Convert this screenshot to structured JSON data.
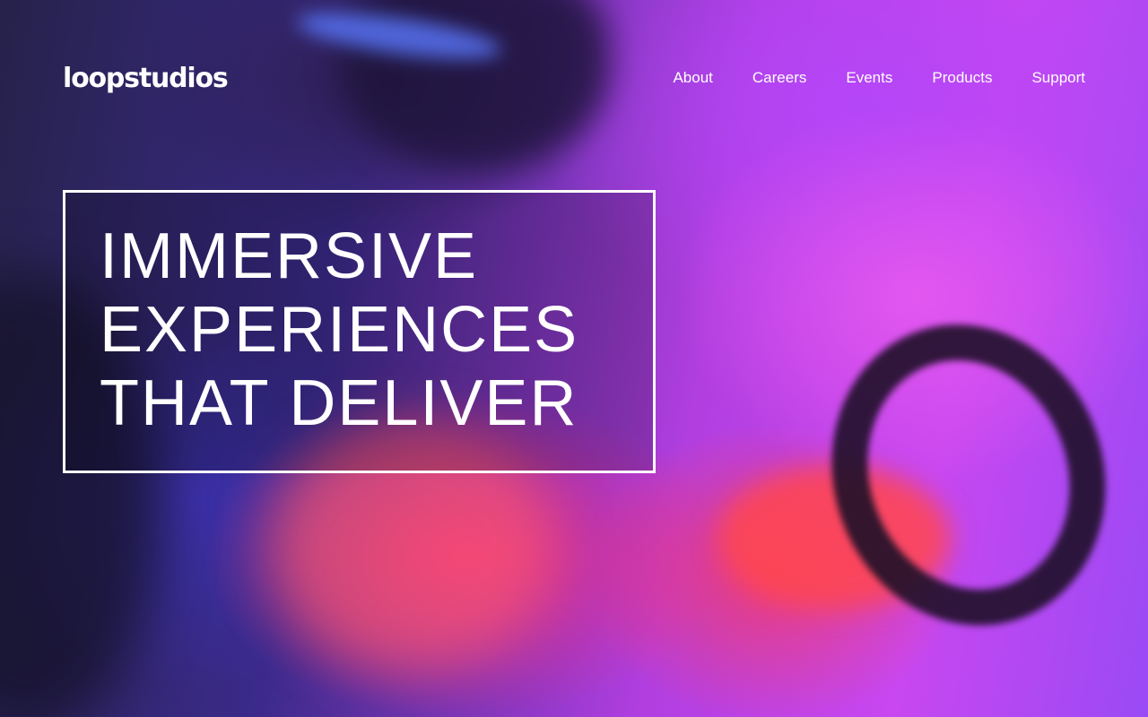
{
  "brand": {
    "logo_text": "loopstudios"
  },
  "nav": {
    "items": [
      {
        "label": "About"
      },
      {
        "label": "Careers"
      },
      {
        "label": "Events"
      },
      {
        "label": "Products"
      },
      {
        "label": "Support"
      }
    ]
  },
  "hero": {
    "title_lines": [
      "IMMERSIVE",
      "EXPERIENCES",
      "THAT DELIVER"
    ],
    "background_image": "vr-headset-driving-photo"
  },
  "colors": {
    "text": "#ffffff",
    "frame": "#ffffff",
    "magenta": "#c847f0",
    "red": "#f52d78",
    "navy": "#26224a"
  }
}
